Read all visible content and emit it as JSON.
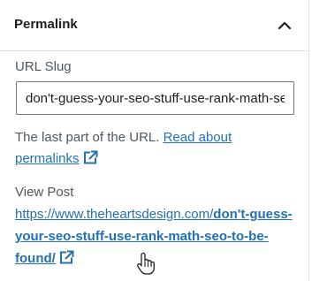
{
  "permalink_panel": {
    "title": "Permalink",
    "slug_label": "URL Slug",
    "slug_value": "don't-guess-your-seo-stuff-use-rank-math-seo-to-be-found",
    "help_text": "The last part of the URL.",
    "help_link": "Read about permalinks",
    "view_post_label": "View Post",
    "view_post_url_base": "https://www.theheartsdesign.com/",
    "view_post_url_slug": "don't-guess-your-seo-stuff-use-rank-math-seo-to-be-found/"
  },
  "icons": {
    "toggle": "chevron-up-icon",
    "external": "external-link-icon",
    "cursor": "hand-pointer-icon"
  },
  "colors": {
    "link": "#2271b1",
    "muted_text": "#50575e",
    "text": "#1e1e1e",
    "border": "#e0e0e0",
    "input_border": "#757575"
  }
}
